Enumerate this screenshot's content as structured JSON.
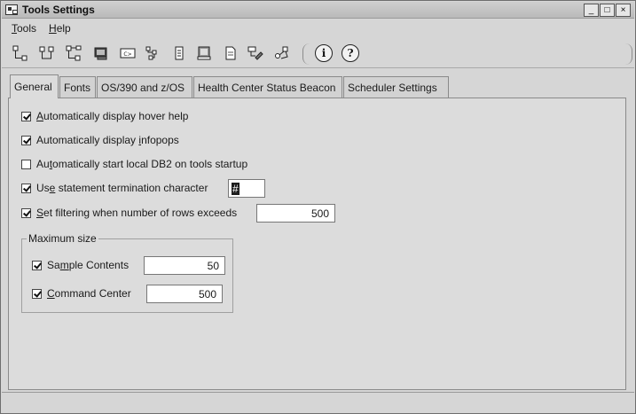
{
  "window": {
    "title": "Tools Settings",
    "controls": {
      "minimize": "_",
      "maximize": "□",
      "close": "×"
    }
  },
  "menubar": {
    "items": [
      {
        "label": "Tools",
        "mnemonic": "T",
        "rest": "ools"
      },
      {
        "label": "Help",
        "mnemonic": "H",
        "rest": "elp"
      }
    ]
  },
  "toolbar": {
    "icons": [
      "control-center-icon",
      "replication-center-icon",
      "satellite-admin-icon",
      "command-editor-icon",
      "command-window-icon",
      "task-center-icon",
      "health-center-icon",
      "journal-icon",
      "license-center-icon",
      "configuration-assistant-icon",
      "development-center-icon"
    ],
    "info_glyph": "i",
    "help_glyph": "?"
  },
  "tabs": [
    {
      "label": "General",
      "active": true
    },
    {
      "label": "Fonts",
      "active": false
    },
    {
      "label": "OS/390 and z/OS",
      "active": false
    },
    {
      "label": "Health Center Status Beacon",
      "active": false
    },
    {
      "label": "Scheduler Settings",
      "active": false
    }
  ],
  "general": {
    "hover_help": {
      "pre": "",
      "mn": "A",
      "post": "utomatically display hover help",
      "checked": true
    },
    "infopops": {
      "pre": "Automatically display ",
      "mn": "i",
      "post": "nfopops",
      "checked": true
    },
    "start_db2": {
      "pre": "Au",
      "mn": "t",
      "post": "omatically start local DB2 on tools startup",
      "checked": false
    },
    "termination": {
      "pre": "Us",
      "mn": "e",
      "post": " statement termination character",
      "checked": true,
      "value": "#"
    },
    "filtering": {
      "pre": "",
      "mn": "S",
      "post": "et filtering when number of rows exceeds",
      "checked": true,
      "value": "500"
    },
    "max_size": {
      "title": "Maximum size",
      "sample_contents": {
        "pre": "Sa",
        "mn": "m",
        "post": "ple Contents",
        "checked": true,
        "value": "50"
      },
      "command_center": {
        "pre": "",
        "mn": "C",
        "post": "ommand Center",
        "checked": true,
        "value": "500"
      }
    }
  },
  "colors": {
    "window_bg": "#d6d6d6",
    "panel_bg": "#dcdcdc",
    "border": "#8a8a8a"
  }
}
